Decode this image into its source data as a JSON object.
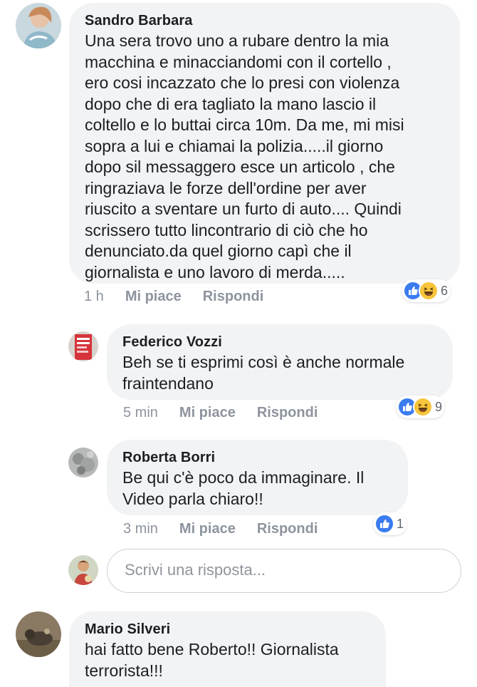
{
  "comments": [
    {
      "author": "Sandro Barbara",
      "text": "Una sera trovo uno a rubare dentro la mia\nmacchina e minacciandomi con il cortello ,\nero cosi incazzato che lo presi con violenza\ndopo che di era tagliato la mano lascio il\ncoltello e lo buttai circa 10m. Da me, mi misi\nsopra a lui e chiamai la polizia.....il giorno\ndopo sil messaggero esce un articolo , che\nringraziava le forze dell'ordine per aver\nriuscito a sventare un furto di auto.... Quindi\nscrissero tutto lincontrario di ciò che ho\ndenunciato.da quel giorno capì che il\ngiornalista e uno lavoro di merda.....",
      "time": "1 h",
      "like_label": "Mi piace",
      "reply_label": "Rispondi",
      "reaction_count": "6",
      "reactions": [
        "like-icon",
        "haha-icon"
      ]
    },
    {
      "author": "Federico Vozzi",
      "text": "Beh se ti esprimi così è anche normale\nfraintendano",
      "time": "5 min",
      "like_label": "Mi piace",
      "reply_label": "Rispondi",
      "reaction_count": "9",
      "reactions": [
        "like-icon",
        "haha-icon"
      ]
    },
    {
      "author": "Roberta Borri",
      "text": "Be qui c'è poco da immaginare. Il\nVideo parla chiaro!!",
      "time": "3 min",
      "like_label": "Mi piace",
      "reply_label": "Rispondi",
      "reaction_count": "1",
      "reactions": [
        "like-icon"
      ]
    },
    {
      "author": "Mario Silveri",
      "text": "hai fatto bene Roberto!! Giornalista\nterrorista!!!"
    }
  ],
  "reply_box": {
    "placeholder": "Scrivi una risposta..."
  },
  "colors": {
    "like_blue": "#3b7bf0",
    "haha_yellow": "#f7c43a",
    "bubble_bg": "#f2f3f5",
    "meta_gray": "#8d949e"
  }
}
